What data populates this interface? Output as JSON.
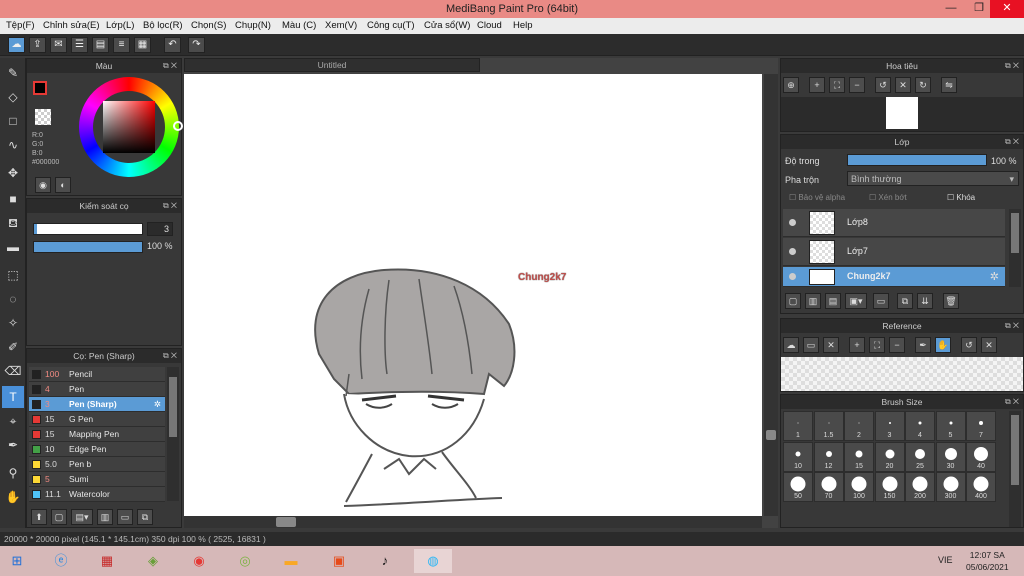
{
  "window": {
    "title": "MediBang Paint Pro (64bit)"
  },
  "menu": [
    "Tệp(F)",
    "Chỉnh sửa(E)",
    "Lớp(L)",
    "Bộ lọc(R)",
    "Chọn(S)",
    "Chụp(N)",
    "Màu (C)",
    "Xem(V)",
    "Công cụ(T)",
    "Cửa sổ(W)",
    "Cloud",
    "Help"
  ],
  "color_panel": {
    "title": "Màu",
    "r": "R:0",
    "g": "G:0",
    "b": "B:0",
    "hex": "#000000"
  },
  "brush_control": {
    "title": "Kiểm soát cọ",
    "size": "3",
    "opacity": "100 %"
  },
  "brush_panel": {
    "title": "Cọ: Pen (Sharp)",
    "items": [
      {
        "size": "100",
        "name": "Pencil",
        "color": "#222222"
      },
      {
        "size": "4",
        "name": "Pen",
        "color": "#222222"
      },
      {
        "size": "3",
        "name": "Pen (Sharp)",
        "color": "#222222"
      },
      {
        "size": "15",
        "name": "G Pen",
        "color": "#e53935"
      },
      {
        "size": "15",
        "name": "Mapping Pen",
        "color": "#e53935"
      },
      {
        "size": "10",
        "name": "Edge Pen",
        "color": "#43a047"
      },
      {
        "size": "5.0",
        "name": "Pen b",
        "color": "#fdd835"
      },
      {
        "size": "5",
        "name": "Sumi",
        "color": "#fdd835"
      },
      {
        "size": "11.1",
        "name": "Watercolor",
        "color": "#4fc3f7"
      }
    ]
  },
  "document": {
    "tab": "Untitled",
    "watermark_text": "Chung2k7"
  },
  "navigator": {
    "title": "Hoa tiêu"
  },
  "layer_panel": {
    "title": "Lớp",
    "opacity_label": "Độ trong",
    "opacity_value": "100 %",
    "blend_label": "Pha trộn",
    "blend_value": "Bình thường",
    "protect_alpha": "Bảo vệ alpha",
    "clipping": "Xén bớt",
    "lock": "Khóa",
    "layers": [
      "Lớp8",
      "Lớp7",
      "Chung2k7"
    ]
  },
  "reference": {
    "title": "Reference"
  },
  "brush_size": {
    "title": "Brush Size",
    "sizes": [
      "1",
      "1.5",
      "2",
      "3",
      "4",
      "5",
      "7",
      "10",
      "12",
      "15",
      "20",
      "25",
      "30",
      "40",
      "50",
      "70",
      "100",
      "150",
      "200",
      "300",
      "400"
    ]
  },
  "status": {
    "text": "20000 * 20000 pixel   (145.1 * 145.1cm)   350 dpi   100 %   ( 2525, 16831 )"
  },
  "taskbar": {
    "lang": "VIE",
    "time": "12:07 SA",
    "date": "05/06/2021"
  }
}
